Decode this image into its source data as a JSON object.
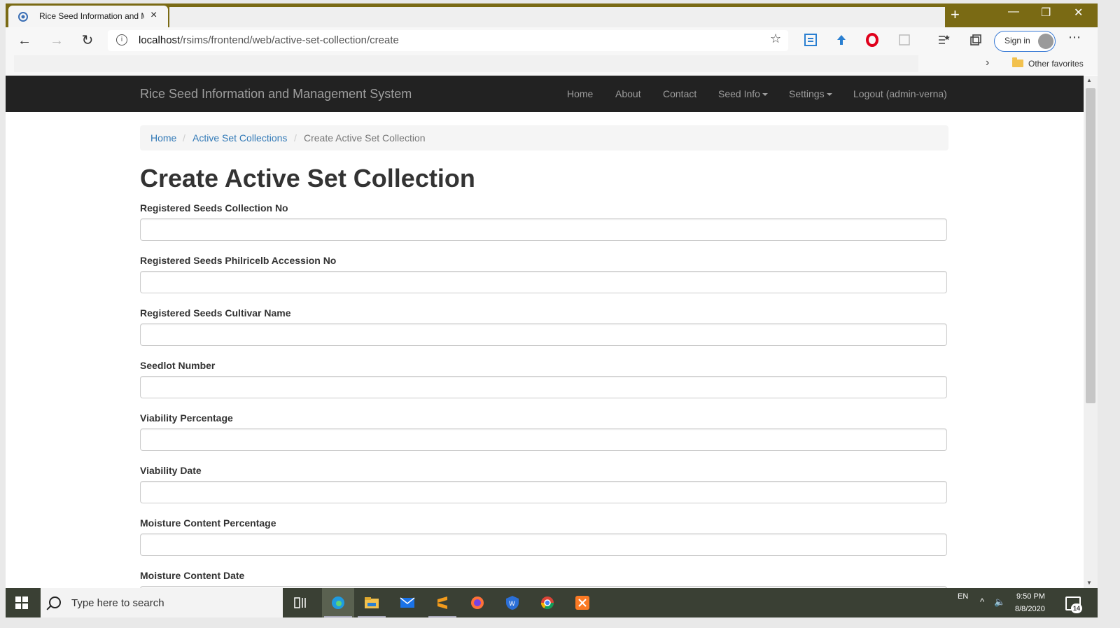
{
  "browser": {
    "tab_title": "Rice Seed Information and Ma",
    "tab_close": "×",
    "new_tab": "+",
    "minimize": "—",
    "restore": "❐",
    "close": "✕",
    "url_host": "localhost",
    "url_path": "/rsims/frontend/web/active-set-collection/create",
    "sign_in": "Sign in",
    "other_favorites": "Other favorites"
  },
  "site": {
    "brand": "Rice Seed Information and Management System",
    "menu": {
      "home": "Home",
      "about": "About",
      "contact": "Contact",
      "seed_info": "Seed Info",
      "settings": "Settings",
      "logout": "Logout (admin-verna)"
    }
  },
  "breadcrumb": {
    "home": "Home",
    "collections": "Active Set Collections",
    "current": "Create Active Set Collection",
    "separator": "/"
  },
  "page_title": "Create Active Set Collection",
  "form": {
    "fields": [
      {
        "label": "Registered Seeds Collection No",
        "value": ""
      },
      {
        "label": "Registered Seeds Philricelb Accession No",
        "value": ""
      },
      {
        "label": "Registered Seeds Cultivar Name",
        "value": ""
      },
      {
        "label": "Seedlot Number",
        "value": ""
      },
      {
        "label": "Viability Percentage",
        "value": ""
      },
      {
        "label": "Viability Date",
        "value": ""
      },
      {
        "label": "Moisture Content Percentage",
        "value": ""
      },
      {
        "label": "Moisture Content Date",
        "value": ""
      }
    ]
  },
  "taskbar": {
    "search_placeholder": "Type here to search",
    "language": "EN",
    "time": "9:50 PM",
    "date": "8/8/2020",
    "notifications": "14"
  },
  "colors": {
    "navbar_bg": "#222222",
    "link": "#337ab7",
    "titlebar": "#7a6a14",
    "taskbar": "#3a4034"
  }
}
